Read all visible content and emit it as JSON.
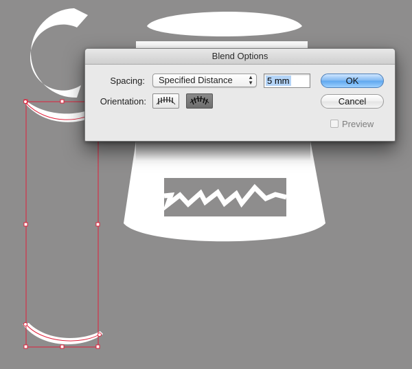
{
  "dialog": {
    "title": "Blend Options",
    "spacing_label": "Spacing:",
    "spacing_value": "Specified Distance",
    "distance_value": "5 mm",
    "orientation_label": "Orientation:",
    "ok_label": "OK",
    "cancel_label": "Cancel",
    "preview_label": "Preview",
    "preview_checked": false
  },
  "colors": {
    "canvas_bg": "#8e8d8d",
    "artwork": "#ffffff",
    "selection": "#e0203a",
    "ok_accent": "#5ea6ee"
  },
  "icons": {
    "orientation_align_to_page": "orientation-align-to-page-icon",
    "orientation_align_to_path": "orientation-align-to-path-icon",
    "select_arrows": "updown-arrows-icon"
  }
}
